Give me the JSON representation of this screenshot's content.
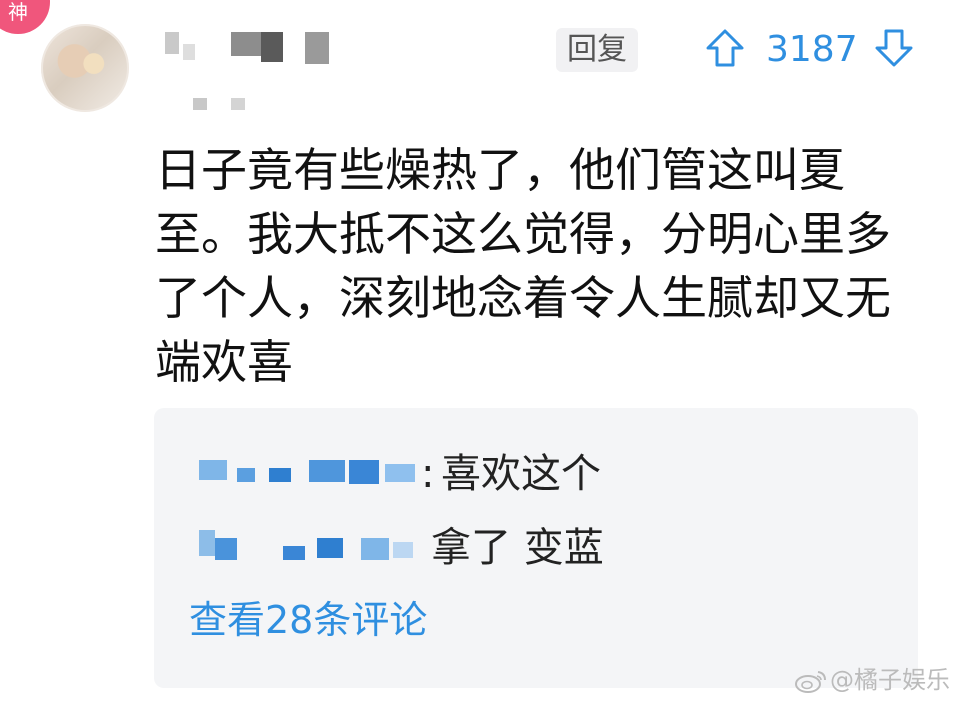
{
  "badge": {
    "text": "神",
    "color": "#f0567c"
  },
  "avatar": {
    "icon": "user-avatar"
  },
  "comment": {
    "reply_label": "回复",
    "vote_count": "3187",
    "accent_color": "#2f8fe0",
    "content_lines": [
      "日子竟有些燥热了，他们管这叫夏",
      "至。我大抵不这么觉得，分明心里多",
      "了个人，深刻地念着令人生腻却又无",
      "端欢喜"
    ]
  },
  "replies": {
    "items": [
      {
        "separator": ":",
        "text": "喜欢这个"
      },
      {
        "separator": "",
        "text": "拿了 变蓝"
      }
    ],
    "view_more": "查看28条评论"
  },
  "watermark": {
    "text": "@橘子娱乐"
  }
}
